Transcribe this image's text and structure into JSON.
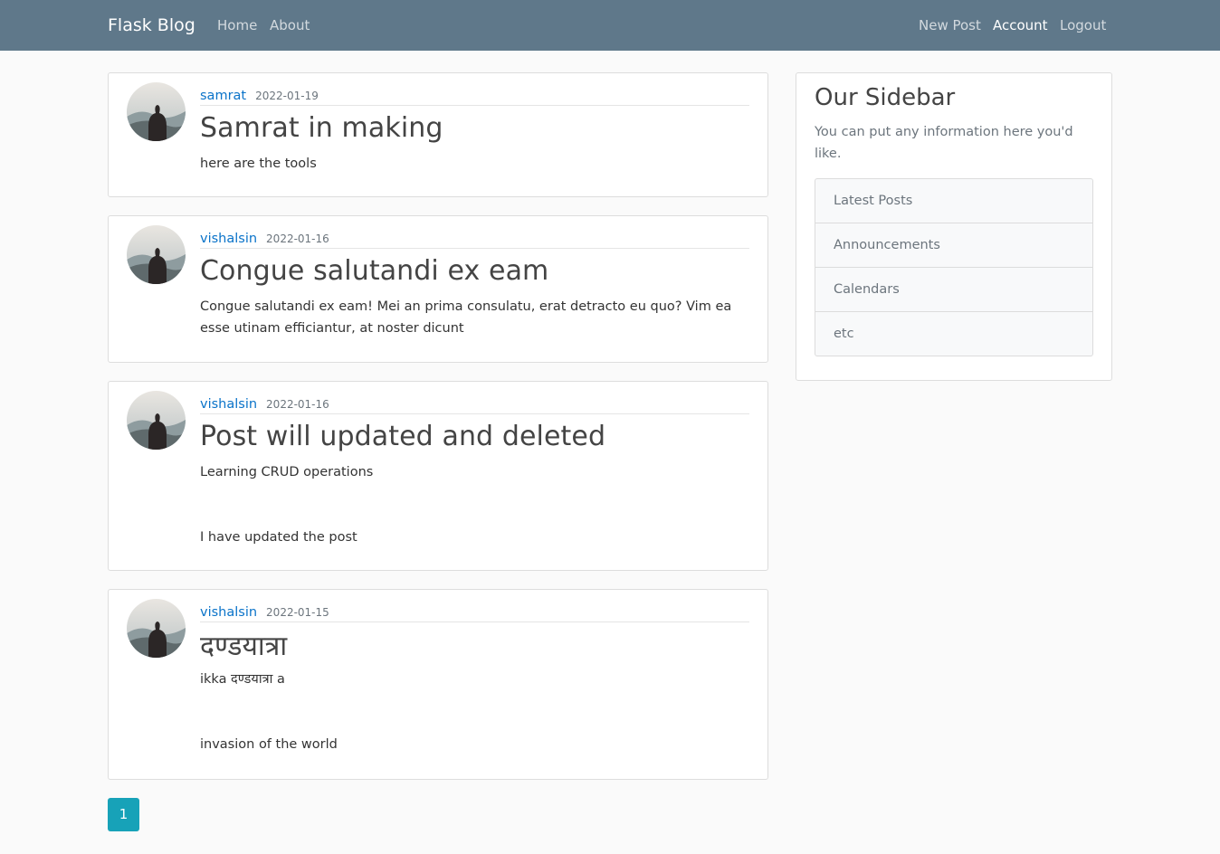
{
  "navbar": {
    "brand": "Flask Blog",
    "left_links": [
      "Home",
      "About"
    ],
    "right_links": [
      "New Post",
      "Account",
      "Logout"
    ],
    "active_link": "Account",
    "background": "#5f788a"
  },
  "posts": [
    {
      "author": "samrat",
      "date": "2022-01-19",
      "title": "Samrat in making",
      "content": "here are the tools"
    },
    {
      "author": "vishalsin",
      "date": "2022-01-16",
      "title": "Congue salutandi ex eam",
      "content": "Congue salutandi ex eam! Mei an prima consulatu, erat detracto eu quo? Vim ea esse utinam efficiantur, at noster dicunt"
    },
    {
      "author": "vishalsin",
      "date": "2022-01-16",
      "title": "Post will updated and deleted",
      "content": "Learning CRUD operations\n\n\nI have updated the post"
    },
    {
      "author": "vishalsin",
      "date": "2022-01-15",
      "title": "दण्डयात्रा",
      "content": "ikka दण्डयात्रा a\n\n\ninvasion of the world"
    }
  ],
  "sidebar": {
    "title": "Our Sidebar",
    "description": "You can put any information here you'd like.",
    "items": [
      "Latest Posts",
      "Announcements",
      "Calendars",
      "etc"
    ]
  },
  "pagination": {
    "pages": [
      "1"
    ],
    "current": "1",
    "accent": "#17a2b8"
  },
  "colors": {
    "link": "#0a73c9",
    "page_background": "#fafafa"
  }
}
